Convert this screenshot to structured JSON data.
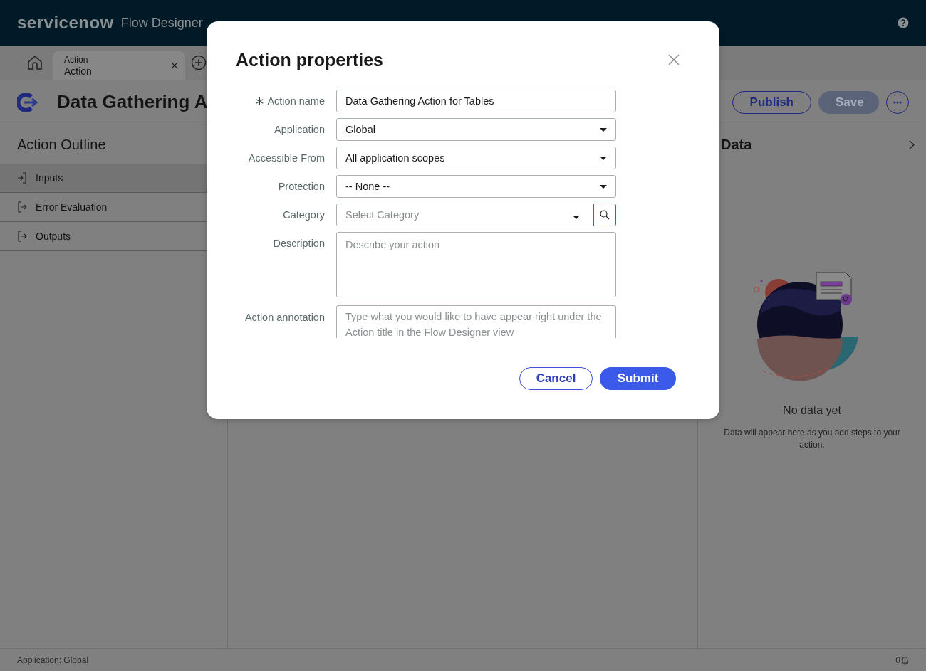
{
  "header": {
    "logo": "servicenow",
    "product": "Flow Designer"
  },
  "tabs": [
    {
      "title": "Action",
      "subtitle": "Action",
      "selected": true
    }
  ],
  "action_header": {
    "title": "Data Gathering A",
    "buttons": [
      {
        "label": "Publish",
        "kind": "outline",
        "disabled": false
      },
      {
        "label": "Save",
        "kind": "filled",
        "disabled": true
      }
    ]
  },
  "outline": {
    "title": "Action Outline",
    "items": [
      {
        "label": "Inputs",
        "kind": "input",
        "selected": true
      },
      {
        "label": "Error Evaluation",
        "kind": "output",
        "selected": false
      },
      {
        "label": "Outputs",
        "kind": "output",
        "selected": false
      }
    ]
  },
  "data_panel": {
    "title": "Data",
    "empty_title": "No data yet",
    "empty_text": "Data will appear here as you add steps to your action."
  },
  "status_bar": {
    "application": "Application: Global",
    "notifications": "0"
  },
  "dialog": {
    "title": "Action properties",
    "fields": [
      {
        "label": "Action name",
        "required": true,
        "kind": "text",
        "value": "Data Gathering Action for Tables"
      },
      {
        "label": "Application",
        "required": false,
        "kind": "select",
        "value": "Global"
      },
      {
        "label": "Accessible From",
        "required": false,
        "kind": "select",
        "value": "All application scopes"
      },
      {
        "label": "Protection",
        "required": false,
        "kind": "select",
        "value": "-- None --"
      },
      {
        "label": "Category",
        "required": false,
        "kind": "lookup",
        "placeholder": "Select Category"
      },
      {
        "label": "Description",
        "required": false,
        "kind": "textarea",
        "placeholder": "Describe your action"
      },
      {
        "label": "Action annotation",
        "required": false,
        "kind": "textarea",
        "placeholder": "Type what you would like to have appear right under the Action title in the Flow Designer view"
      }
    ],
    "buttons": [
      {
        "label": "Cancel",
        "kind": "secondary"
      },
      {
        "label": "Submit",
        "kind": "primary"
      }
    ]
  }
}
